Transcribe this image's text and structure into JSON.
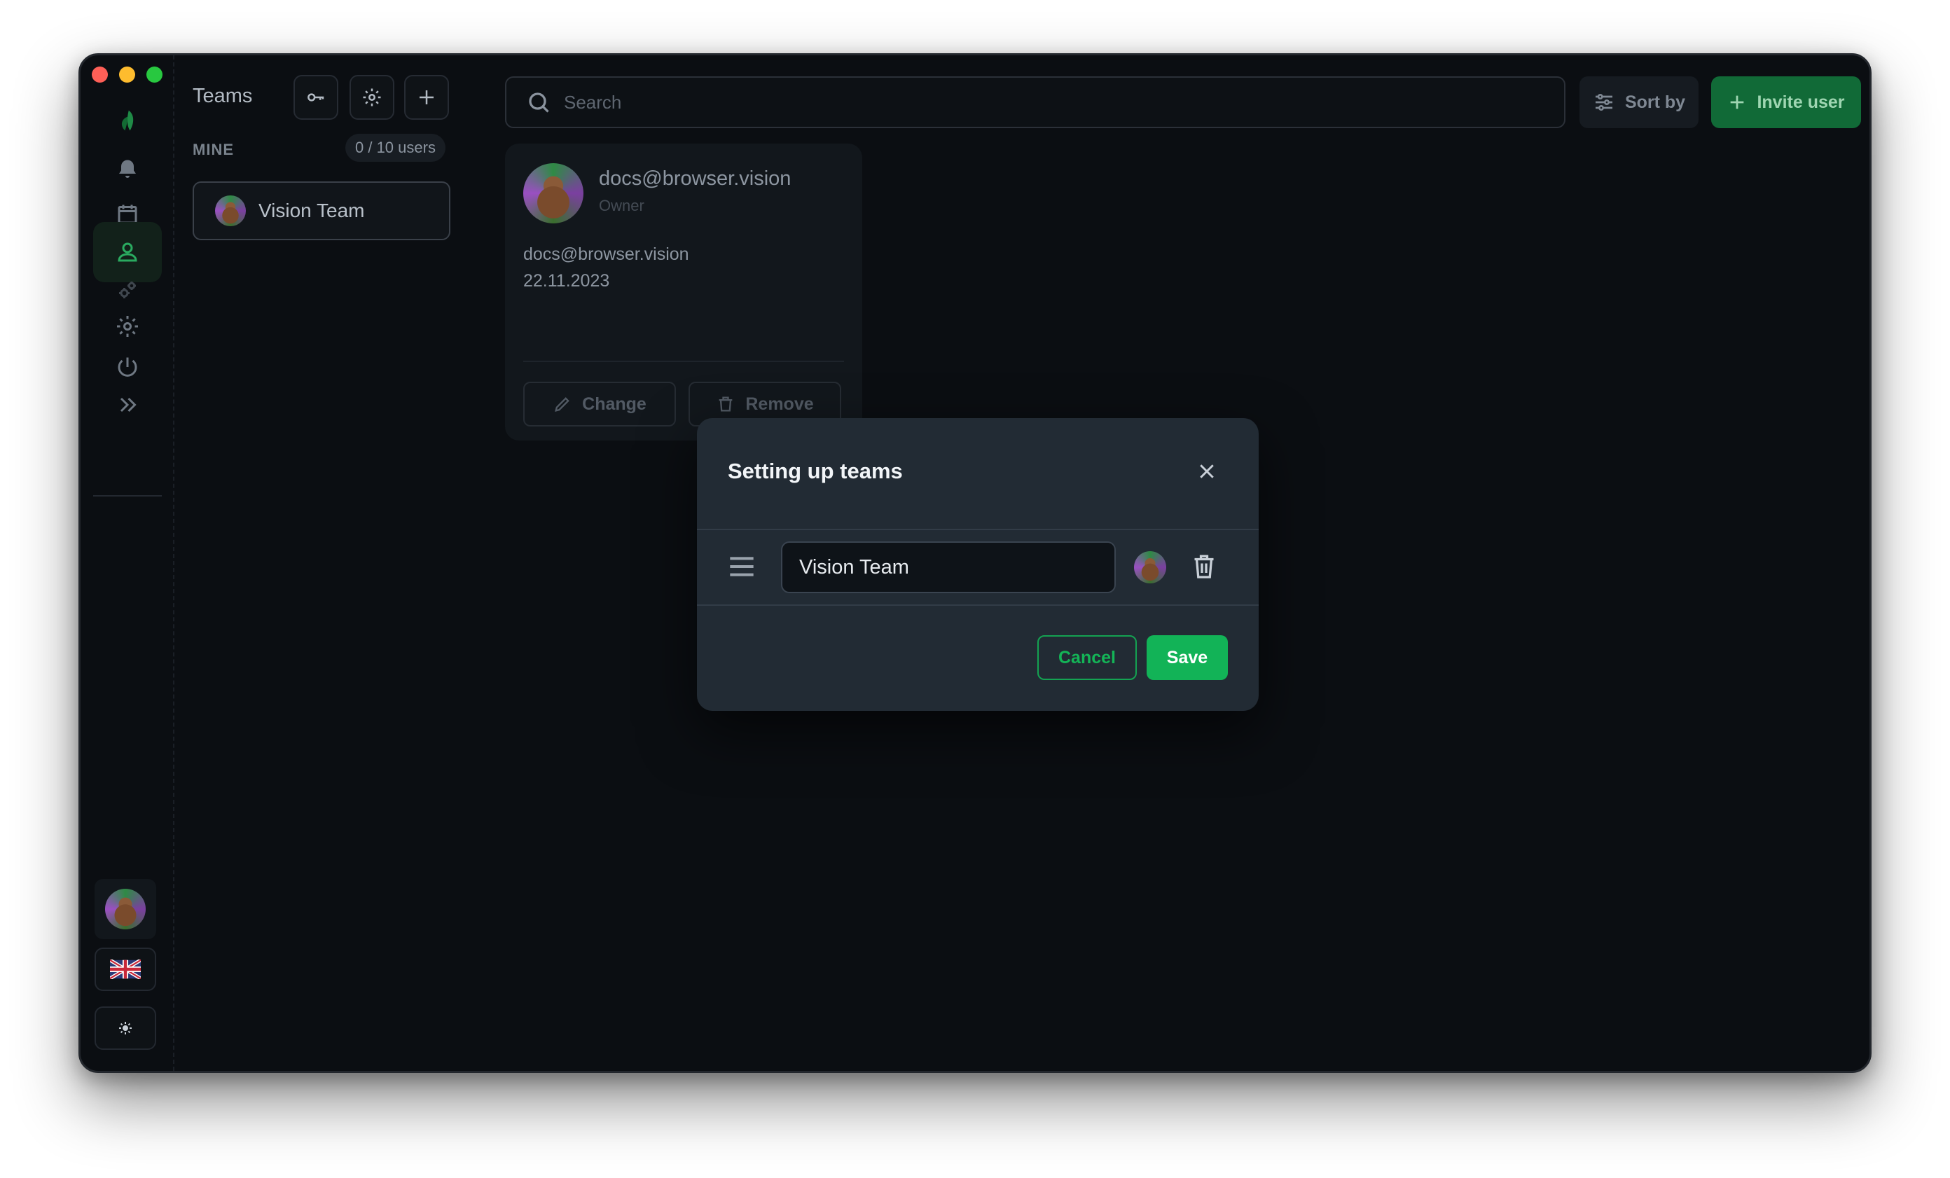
{
  "app": {
    "colors": {
      "accent": "#12b357",
      "background": "#0b0e12",
      "modal": "#222b34"
    }
  },
  "rail": {
    "items": [
      "logo-icon",
      "bell-icon",
      "calendar-icon",
      "user-icon",
      "gears-icon",
      "gear-icon",
      "power-icon",
      "chevrons-right-icon"
    ],
    "active": "user-icon",
    "bottom": [
      "avatar",
      "uk-flag-icon",
      "sun-icon"
    ]
  },
  "teams": {
    "title": "Teams",
    "section_label": "MINE",
    "users_badge": "0 / 10 users",
    "items": [
      {
        "name": "Vision Team"
      }
    ]
  },
  "toolbar": {
    "search_placeholder": "Search",
    "sort_label": "Sort by",
    "invite_label": "Invite user"
  },
  "user_card": {
    "email": "docs@browser.vision",
    "role": "Owner",
    "detail_email": "docs@browser.vision",
    "date": "22.11.2023",
    "change_label": "Change",
    "remove_label": "Remove"
  },
  "modal": {
    "title": "Setting up teams",
    "team_name_value": "Vision Team",
    "cancel_label": "Cancel",
    "save_label": "Save"
  }
}
